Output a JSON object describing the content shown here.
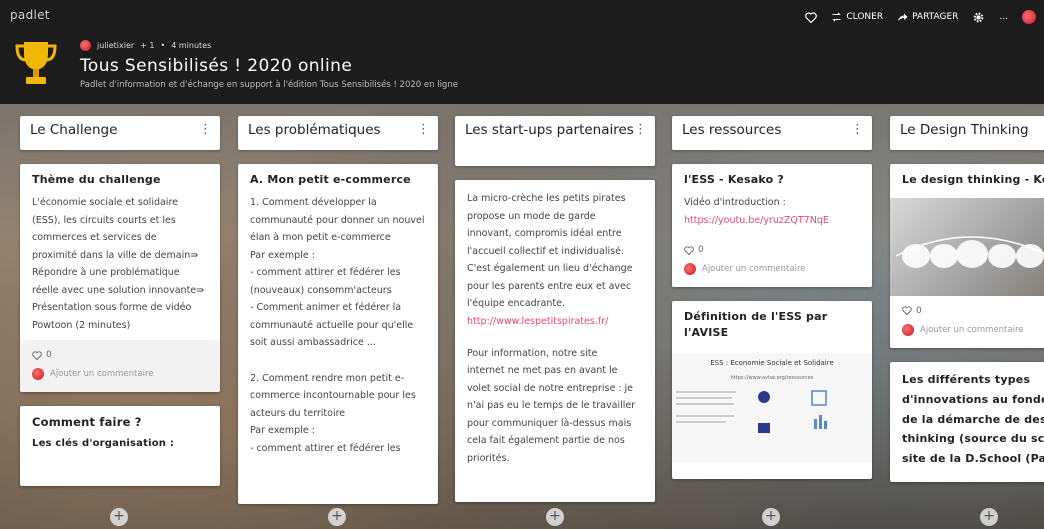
{
  "brand": "padlet",
  "actions": {
    "clone_label": "CLONER",
    "share_label": "PARTAGER",
    "more_label": "..."
  },
  "meta": {
    "author": "julietixier",
    "plus": "+ 1",
    "separator": "•",
    "time": "4 minutes"
  },
  "title": "Tous Sensibilisés ! 2020 online",
  "subtitle": "Padlet d'information et d'échange en support à l'édition Tous Sensibilisés ! 2020 en ligne",
  "columns": [
    {
      "header": "Le Challenge",
      "cards": [
        {
          "title": "Thème du challenge",
          "text": "L'économie sociale et solidaire\n(ESS), les circuits courts et les\ncommerces et services de\nproximité dans la ville de demain⇛\nRépondre à une problématique\nréelle avec une solution innovante⇛\nPrésentation sous forme de vidéo\nPowtoon (2 minutes)",
          "likes": "0",
          "comment": "Ajouter un commentaire"
        },
        {
          "title": "Comment faire ?",
          "subtitle": "Les clés d'organisation :"
        }
      ]
    },
    {
      "header": "Les problématiques",
      "cards": [
        {
          "title": "A. Mon petit e-commerce",
          "text": "1. Comment développer la\ncommunauté pour donner un nouvel\nélan à mon petit e-commerce\nPar exemple :\n- comment attirer et fédérer les\n(nouveaux) consomm'acteurs\n- Comment animer et fédérer la\ncommunauté actuelle pour qu'elle\nsoit aussi ambassadrice ...\n\n2. Comment rendre mon petit e-\ncommerce incontournable pour les\nacteurs du territoire\nPar exemple :\n- comment attirer et fédérer les"
        }
      ]
    },
    {
      "header": "Les start-ups partenaires",
      "cards": [
        {
          "text": "La micro-crèche les petits pirates\npropose un mode de garde\ninnovant, compromis idéal entre\nl'accueil collectif et individualisé.\nC'est également un lieu d'échange\npour les parents entre eux et avec\nl'équipe encadrante.",
          "link": "http://www.lespetitspirates.fr/",
          "text2": "Pour information, notre site\ninternet ne met pas en avant le\nvolet social de notre entreprise : je\nn'ai pas eu le temps de le travailler\npour communiquer là-dessus mais\ncela fait également partie de nos\npriorités."
        }
      ]
    },
    {
      "header": "Les ressources",
      "cards": [
        {
          "title": "l'ESS - Kesako ?",
          "text": "Vidéo d'introduction :",
          "link": "https://youtu.be/yruzZQT7NqE",
          "likes": "0",
          "comment": "Ajouter un commentaire"
        },
        {
          "title": "Définition de l'ESS par l'AVISE",
          "image_title": "ESS : Economie Sociale et Solidaire",
          "image_url": "https://www.avise.org/ressources"
        }
      ]
    },
    {
      "header": "Le Design Thinking",
      "cards": [
        {
          "title": "Le design thinking - Kesa",
          "likes": "0",
          "comment": "Ajouter un commentaire"
        },
        {
          "title": "Les différents types d'innovations au fondeme de la démarche de design thinking (source du sché site de la D.School (Paris"
        }
      ]
    }
  ],
  "add_label": "+",
  "colors": {
    "topbar": "#1c1c1c",
    "link": "#e8467c",
    "card": "#ffffff"
  }
}
